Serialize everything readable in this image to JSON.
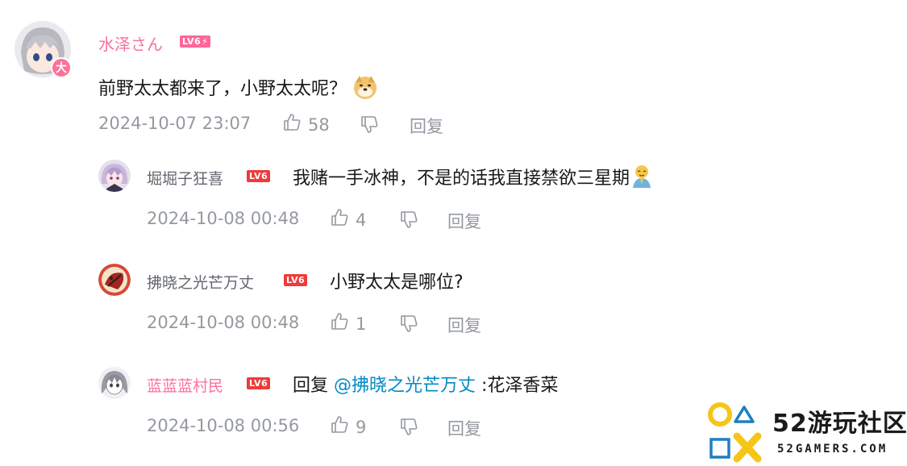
{
  "comment": {
    "username": "水泽さん",
    "level": "LV6",
    "text": "前野太太都来了，小野太太呢？",
    "emoji": "doge-emoji",
    "time": "2024-10-07 23:07",
    "likes": "58",
    "reply_label": "回复",
    "avatar_badge": "大"
  },
  "replies": [
    {
      "username": "堀堀子狂喜",
      "level": "LV6",
      "text": "我赌一手冰神，不是的话我直接禁欲三星期",
      "emoji": "praying-emoji",
      "time": "2024-10-08 00:48",
      "likes": "4",
      "reply_label": "回复"
    },
    {
      "username": "拂晓之光芒万丈",
      "level": "LV6",
      "text": "小野太太是哪位?",
      "time": "2024-10-08 00:48",
      "likes": "1",
      "reply_label": "回复"
    },
    {
      "username": "蓝蓝蓝村民",
      "level": "LV6",
      "prefix": "回复 ",
      "mention": "@拂晓之光芒万丈",
      "suffix": " :花泽香菜",
      "time": "2024-10-08 00:56",
      "likes": "9",
      "reply_label": "回复"
    }
  ],
  "watermark": {
    "name": "52游玩社区",
    "url": "52GAMERS.COM"
  },
  "colors": {
    "pink": "#fb7299",
    "gray_text": "#9499a0",
    "link": "#008ac5",
    "level_badge": "#ee3b3b",
    "logo_yellow": "#f5c518",
    "logo_blue": "#1f7fbf"
  }
}
